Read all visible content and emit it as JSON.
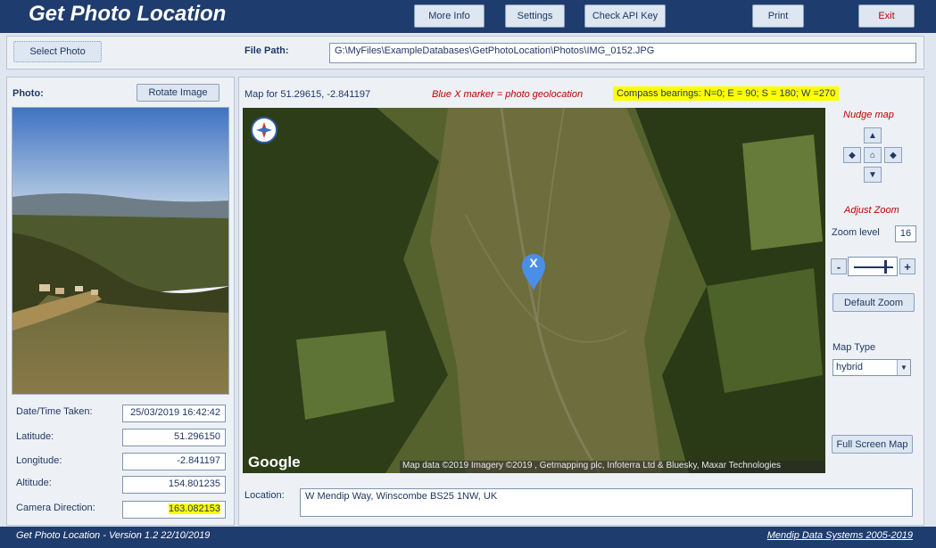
{
  "header": {
    "title": "Get Photo Location",
    "buttons": {
      "more_info": "More Info",
      "settings": "Settings",
      "check_api_key": "Check API Key",
      "print": "Print",
      "exit": "Exit"
    }
  },
  "file_row": {
    "select_photo": "Select Photo",
    "file_path_label": "File Path:",
    "file_path_value": "G:\\MyFiles\\ExampleDatabases\\GetPhotoLocation\\Photos\\IMG_0152.JPG"
  },
  "photo_panel": {
    "photo_label": "Photo:",
    "rotate_button": "Rotate Image",
    "fields": [
      {
        "label": "Date/Time Taken:",
        "value": "25/03/2019 16:42:42"
      },
      {
        "label": "Latitude:",
        "value": "51.296150"
      },
      {
        "label": "Longitude:",
        "value": "-2.841197"
      },
      {
        "label": "Altitude:",
        "value": "154.801235"
      },
      {
        "label": "Camera Direction:",
        "value": "163.082153"
      }
    ]
  },
  "map_panel": {
    "map_for": "Map for 51.29615, -2.841197",
    "marker_note": "Blue X marker = photo geolocation",
    "compass_note": "Compass bearings: N=0; E = 90; S = 180; W =270",
    "marker_letter": "X",
    "google_logo": "Google",
    "attribution": "Map data ©2019  Imagery ©2019 , Getmapping plc, Infoterra Ltd & Bluesky, Maxar Technologies",
    "location_label": "Location:",
    "location_value": "W Mendip Way, Winscombe BS25 1NW, UK"
  },
  "controls": {
    "nudge_map": "Nudge map",
    "nudge_up": "▲",
    "nudge_down": "▼",
    "nudge_left": "◆",
    "nudge_right": "◆",
    "home": "⌂",
    "adjust_zoom": "Adjust Zoom",
    "zoom_level_label": "Zoom level",
    "zoom_level_value": "16",
    "zoom_minus": "-",
    "zoom_plus": "+",
    "zoom_slider_fraction": 0.8,
    "default_zoom": "Default Zoom",
    "map_type_label": "Map Type",
    "map_type_value": "hybrid",
    "full_screen_map": "Full Screen Map"
  },
  "status": {
    "left": "Get Photo Location - Version 1.2  22/10/2019",
    "right": "Mendip Data Systems 2005-2019"
  },
  "colors": {
    "title_bar": "#1f3c6e",
    "highlight": "#ffff00",
    "marker": "#4a8ee8"
  }
}
